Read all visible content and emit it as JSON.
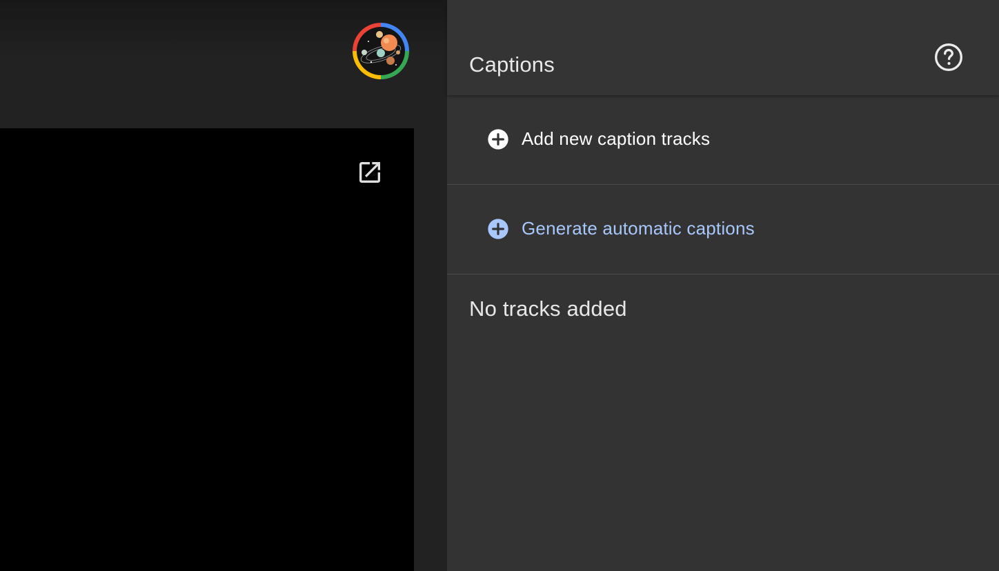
{
  "header": {
    "avatar_icon": "user-avatar-solar-system"
  },
  "video": {
    "open_icon": "open-in-new-icon"
  },
  "captions_panel": {
    "title": "Captions",
    "help_icon": "help-circle-icon",
    "actions": [
      {
        "label": "Add new caption tracks",
        "icon": "add-circle-icon",
        "color": "#ffffff"
      },
      {
        "label": "Generate automatic captions",
        "icon": "add-circle-icon",
        "color": "#a8c7fa"
      }
    ],
    "empty_message": "No tracks added"
  }
}
